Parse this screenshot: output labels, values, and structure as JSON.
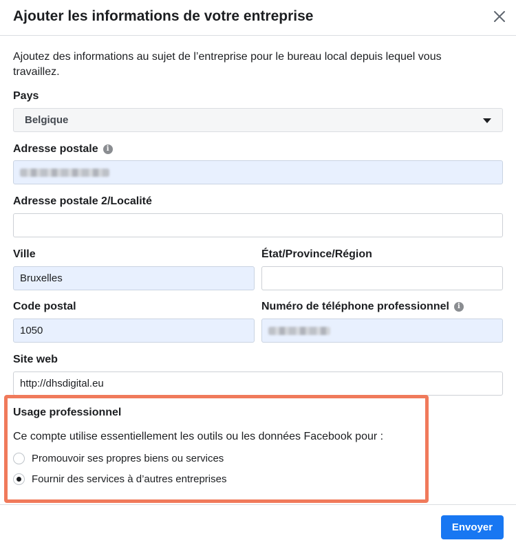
{
  "dialog": {
    "title": "Ajouter les informations de votre entreprise",
    "intro": "Ajoutez des informations au sujet de l’entreprise pour le bureau local depuis lequel vous travaillez."
  },
  "form": {
    "country": {
      "label": "Pays",
      "value": "Belgique"
    },
    "address": {
      "label": "Adresse postale",
      "value": "[blurred]",
      "info_icon": "info-icon"
    },
    "address2": {
      "label": "Adresse postale 2/Localité",
      "value": ""
    },
    "city": {
      "label": "Ville",
      "value": "Bruxelles"
    },
    "state": {
      "label": "État/Province/Région",
      "value": ""
    },
    "postal_code": {
      "label": "Code postal",
      "value": "1050"
    },
    "phone": {
      "label": "Numéro de téléphone professionnel",
      "value": "[blurred]",
      "info_icon": "info-icon"
    },
    "website": {
      "label": "Site web",
      "value": "http://dhsdigital.eu"
    }
  },
  "usage": {
    "title": "Usage professionnel",
    "description": "Ce compte utilise essentiellement les outils ou les données Facebook pour :",
    "options": [
      {
        "label": "Promouvoir ses propres biens ou services",
        "checked": false
      },
      {
        "label": "Fournir des services à d’autres entreprises",
        "checked": true
      }
    ],
    "highlight_color": "#f07a5b"
  },
  "footer": {
    "submit_label": "Envoyer",
    "accent": "#1877f2"
  },
  "colors": {
    "filled_field": "#e8f0fe",
    "border": "#ccd0d5"
  }
}
